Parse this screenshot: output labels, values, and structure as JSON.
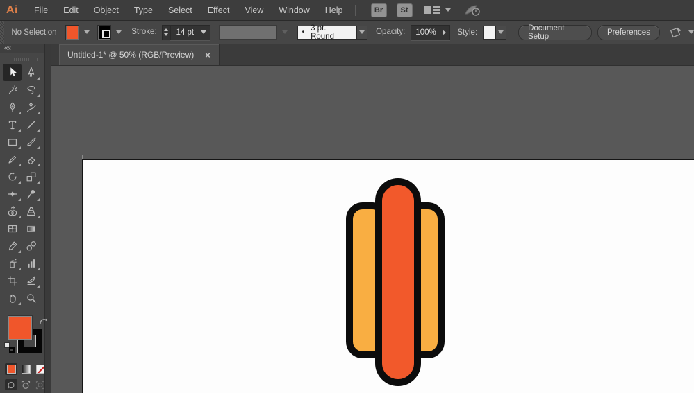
{
  "app": {
    "logo": "Ai",
    "bridge_label": "Br",
    "stock_label": "St"
  },
  "menubar": {
    "items": [
      "File",
      "Edit",
      "Object",
      "Type",
      "Select",
      "Effect",
      "View",
      "Window",
      "Help"
    ]
  },
  "controlbar": {
    "selection_status": "No Selection",
    "stroke_label": "Stroke:",
    "stroke_width": "14 pt",
    "brush_bullet": "•",
    "brush_name": "3 pt. Round",
    "opacity_label": "Opacity:",
    "opacity_value": "100%",
    "style_label": "Style:",
    "document_setup_label": "Document Setup",
    "preferences_label": "Preferences",
    "fill_color": "#F0562B",
    "stroke_color": "#000000"
  },
  "tabbar": {
    "active_tab": "Untitled-1* @ 50% (RGB/Preview)",
    "close_glyph": "×"
  },
  "toolbar": {
    "active_tool": "selection-tool",
    "tools": [
      "selection-tool",
      "direct-selection-tool",
      "magic-wand-tool",
      "lasso-tool",
      "pen-tool",
      "curvature-tool",
      "type-tool",
      "line-segment-tool",
      "rectangle-tool",
      "paintbrush-tool",
      "pencil-tool",
      "eraser-tool",
      "rotate-tool",
      "scale-tool",
      "width-tool",
      "puppet-warp-tool",
      "shape-builder-tool",
      "perspective-grid-tool",
      "mesh-tool",
      "gradient-tool",
      "eyedropper-tool",
      "blend-tool",
      "symbol-sprayer-tool",
      "column-graph-tool",
      "artboard-tool",
      "slice-tool",
      "hand-tool",
      "zoom-tool"
    ],
    "fill_color": "#F0562B",
    "stroke_color": "#000000"
  },
  "artwork": {
    "description": "hot-dog icon of three rounded vertical bars",
    "bun_color": "#F9AE42",
    "sausage_color": "#F2592B",
    "outline_color": "#0C0C0C"
  }
}
